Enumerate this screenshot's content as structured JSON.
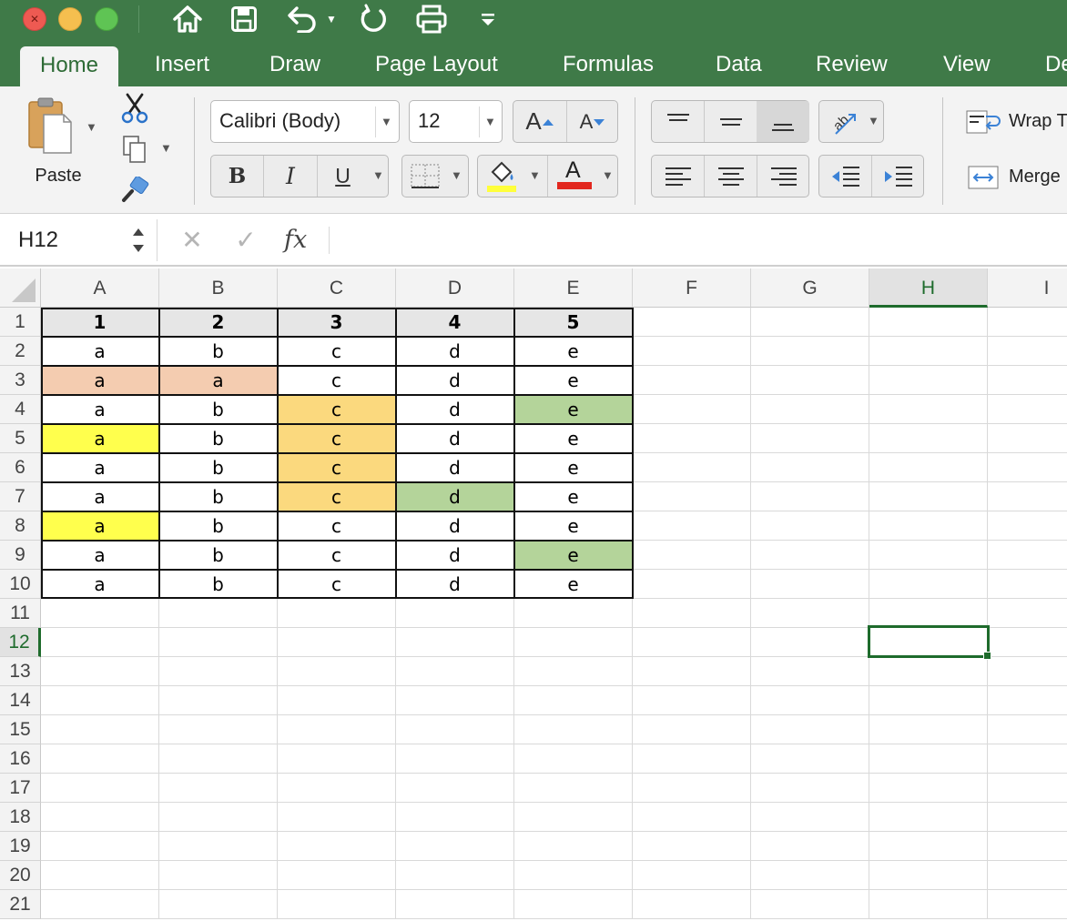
{
  "titlebar": {
    "quick_access": [
      "home",
      "save",
      "undo",
      "redo",
      "print",
      "customize"
    ]
  },
  "tabs": [
    "Home",
    "Insert",
    "Draw",
    "Page Layout",
    "Formulas",
    "Data",
    "Review",
    "View",
    "De"
  ],
  "active_tab": "Home",
  "ribbon": {
    "paste_label": "Paste",
    "font_name": "Calibri (Body)",
    "font_size": "12",
    "bold": "B",
    "italic": "I",
    "underline": "U",
    "increase_font": "A",
    "decrease_font": "A",
    "font_color_glyph": "A",
    "wrap_label": "Wrap T",
    "merge_label": "Merge",
    "fill_color": "#ffff3b",
    "font_color": "#e2271e"
  },
  "formula_bar": {
    "name_box": "H12",
    "cancel_icon": "✕",
    "enter_icon": "✓",
    "fx_label": "fx",
    "formula": ""
  },
  "sheet": {
    "columns": [
      "A",
      "B",
      "C",
      "D",
      "E",
      "F",
      "G",
      "H",
      "I"
    ],
    "rows": [
      "1",
      "2",
      "3",
      "4",
      "5",
      "6",
      "7",
      "8",
      "9",
      "10",
      "11",
      "12",
      "13",
      "14",
      "15",
      "16",
      "17",
      "18",
      "19",
      "20",
      "21"
    ],
    "selected_cell": "H12",
    "cells": [
      [
        "1",
        "2",
        "3",
        "4",
        "5"
      ],
      [
        "a",
        "b",
        "c",
        "d",
        "e"
      ],
      [
        "a",
        "a",
        "c",
        "d",
        "e"
      ],
      [
        "a",
        "b",
        "c",
        "d",
        "e"
      ],
      [
        "a",
        "b",
        "c",
        "d",
        "e"
      ],
      [
        "a",
        "b",
        "c",
        "d",
        "e"
      ],
      [
        "a",
        "b",
        "c",
        "d",
        "e"
      ],
      [
        "a",
        "b",
        "c",
        "d",
        "e"
      ],
      [
        "a",
        "b",
        "c",
        "d",
        "e"
      ],
      [
        "a",
        "b",
        "c",
        "d",
        "e"
      ]
    ],
    "fills": [
      [
        "#e6e6e6",
        "#e6e6e6",
        "#e6e6e6",
        "#e6e6e6",
        "#e6e6e6"
      ],
      [
        "",
        "",
        "",
        "",
        ""
      ],
      [
        "#f4ccb0",
        "#f4ccb0",
        "",
        "",
        ""
      ],
      [
        "",
        "",
        "#fbd97e",
        "",
        "#b4d49a"
      ],
      [
        "#ffff4d",
        "",
        "#fbd97e",
        "",
        ""
      ],
      [
        "",
        "",
        "#fbd97e",
        "",
        ""
      ],
      [
        "",
        "",
        "#fbd97e",
        "#b4d49a",
        ""
      ],
      [
        "#ffff4d",
        "",
        "",
        "",
        ""
      ],
      [
        "",
        "",
        "",
        "",
        "#b4d49a"
      ],
      [
        "",
        "",
        "",
        "",
        ""
      ]
    ]
  }
}
